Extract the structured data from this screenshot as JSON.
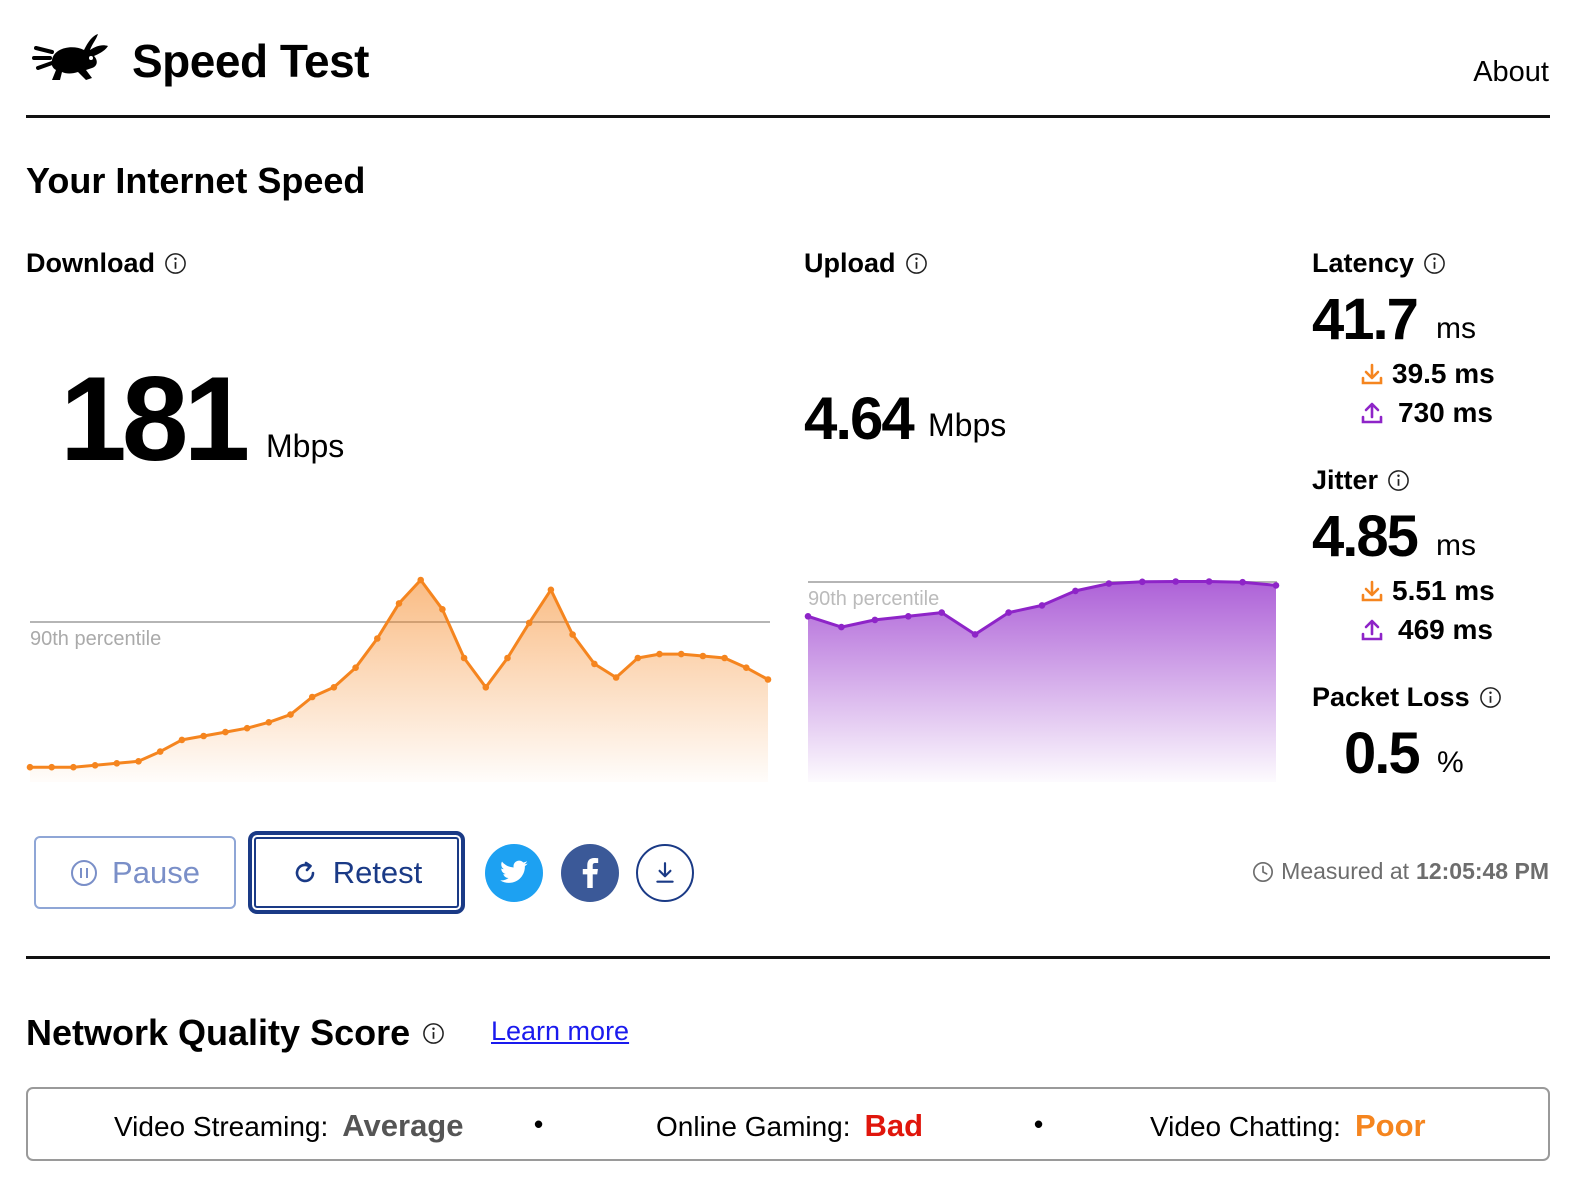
{
  "header": {
    "title": "Speed Test",
    "about_label": "About"
  },
  "section_title": "Your Internet Speed",
  "download": {
    "label": "Download",
    "value": "181",
    "unit": "Mbps",
    "percentile_label": "90th percentile",
    "color": "#f5851f",
    "series_mbps": [
      4,
      4,
      4,
      5,
      6,
      7,
      12,
      18,
      20,
      22,
      24,
      27,
      31,
      40,
      45,
      55,
      70,
      88,
      100,
      85,
      60,
      45,
      60,
      78,
      95,
      72,
      57,
      50,
      60,
      62,
      62,
      61,
      60,
      55,
      49
    ]
  },
  "upload": {
    "label": "Upload",
    "value": "4.64",
    "unit": "Mbps",
    "percentile_label": "90th percentile",
    "color": "#8e24c8",
    "series_mbps": [
      3.7,
      3.4,
      3.6,
      3.7,
      3.8,
      3.2,
      3.8,
      4.0,
      4.4,
      4.6,
      4.65,
      4.66,
      4.66,
      4.64,
      4.55
    ]
  },
  "latency": {
    "label": "Latency",
    "value": "41.7",
    "unit": "ms",
    "down_value": "39.5 ms",
    "up_value": "730 ms"
  },
  "jitter": {
    "label": "Jitter",
    "value": "4.85",
    "unit": "ms",
    "down_value": "5.51 ms",
    "up_value": "469 ms"
  },
  "packet_loss": {
    "label": "Packet Loss",
    "value": "0.5",
    "unit": "%"
  },
  "actions": {
    "pause_label": "Pause",
    "retest_label": "Retest",
    "measured_prefix": "Measured at",
    "measured_time": "12:05:48 PM"
  },
  "network_quality": {
    "title": "Network Quality Score",
    "learn_more": "Learn more",
    "items": [
      {
        "label": "Video Streaming:",
        "value": "Average",
        "color": "#555555"
      },
      {
        "label": "Online Gaming:",
        "value": "Bad",
        "color": "#e0160c"
      },
      {
        "label": "Video Chatting:",
        "value": "Poor",
        "color": "#f5851f"
      }
    ],
    "separator": "•"
  },
  "colors": {
    "download_accent": "#f5851f",
    "upload_accent": "#8e24c8",
    "brand_dark": "#1a3a86"
  }
}
